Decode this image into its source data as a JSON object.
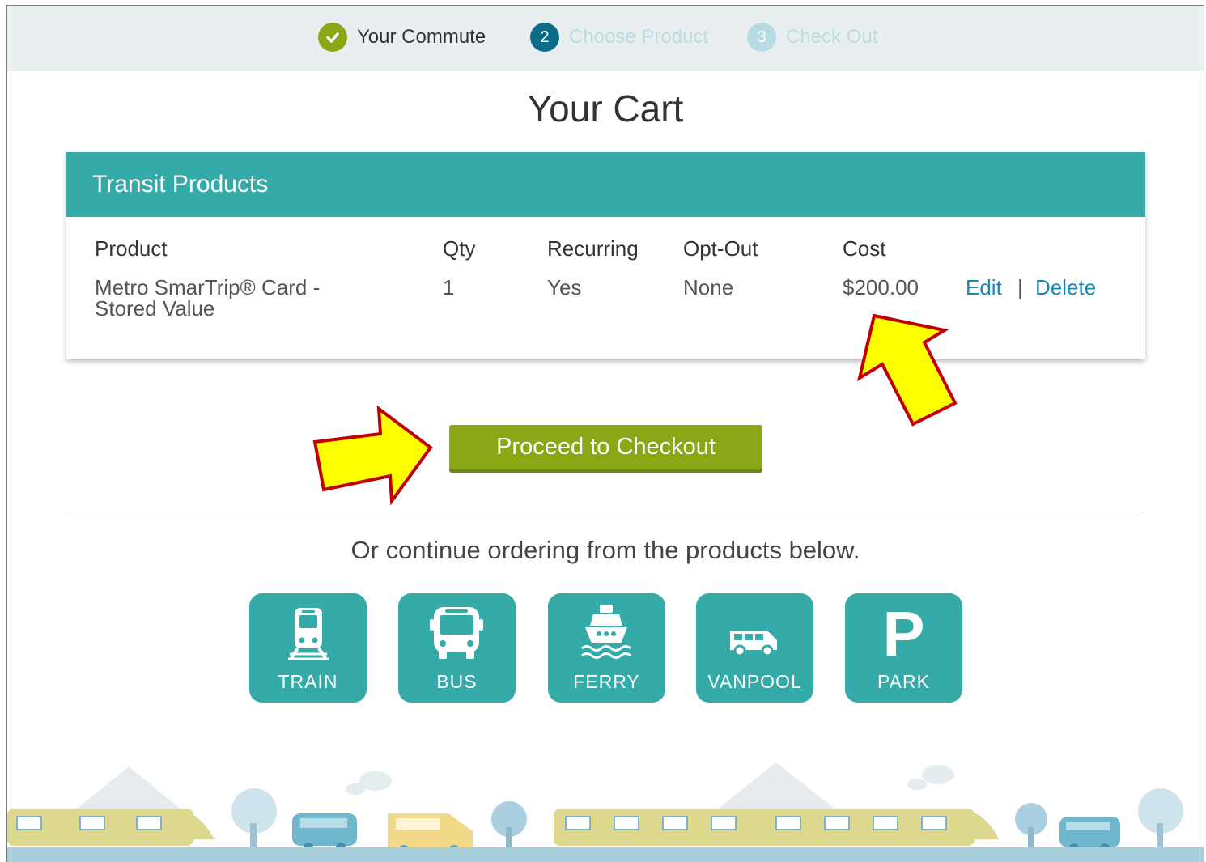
{
  "stepper": {
    "steps": [
      {
        "number": "",
        "label": "Your Commute",
        "state": "complete"
      },
      {
        "number": "2",
        "label": "Choose Product",
        "state": "current"
      },
      {
        "number": "3",
        "label": "Check Out",
        "state": "upcoming"
      }
    ]
  },
  "page": {
    "title": "Your Cart"
  },
  "cart": {
    "section_title": "Transit Products",
    "columns": {
      "product": "Product",
      "qty": "Qty",
      "recurring": "Recurring",
      "opt_out": "Opt-Out",
      "cost": "Cost"
    },
    "rows": [
      {
        "product_line1": "Metro SmarTrip® Card -",
        "product_line2": "Stored Value",
        "qty": "1",
        "recurring": "Yes",
        "opt_out": "None",
        "cost": "$200.00",
        "edit": "Edit",
        "separator": "|",
        "delete": "Delete"
      }
    ]
  },
  "checkout": {
    "label": "Proceed to Checkout"
  },
  "continue_text": "Or continue ordering from the products below.",
  "products": [
    {
      "label": "TRAIN",
      "icon": "train-icon"
    },
    {
      "label": "BUS",
      "icon": "bus-icon"
    },
    {
      "label": "FERRY",
      "icon": "ferry-icon"
    },
    {
      "label": "VANPOOL",
      "icon": "van-icon"
    },
    {
      "label": "PARK",
      "icon": "parking-icon",
      "glyph": "P"
    }
  ],
  "colors": {
    "teal": "#34aba9",
    "green": "#8aa716",
    "link": "#1b87b4",
    "arrow_fill": "#ffff00",
    "arrow_stroke": "#c00000"
  }
}
